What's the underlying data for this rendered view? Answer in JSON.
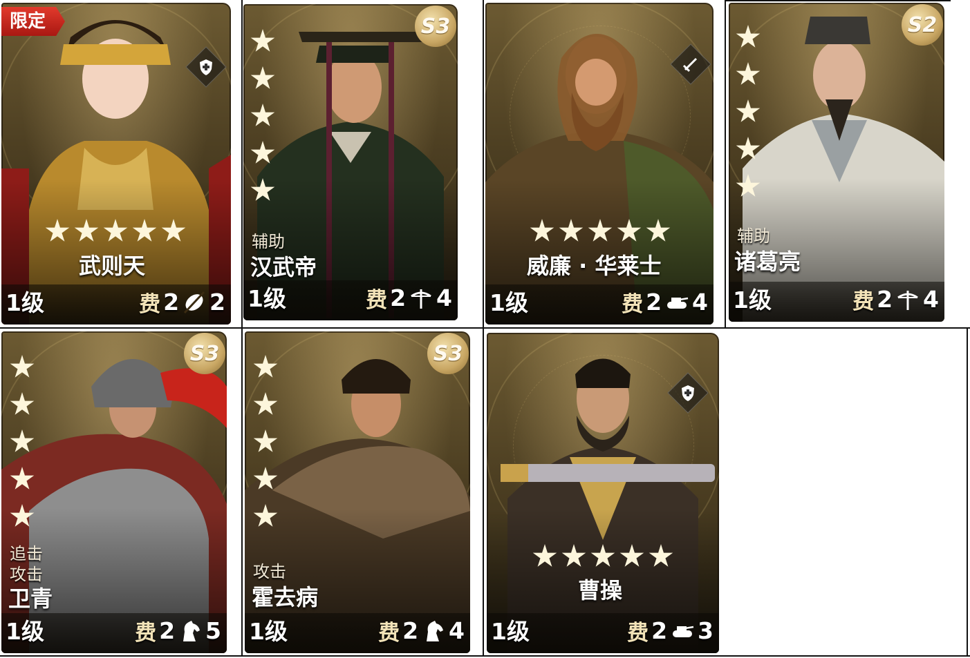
{
  "cards": [
    {
      "id": "c1",
      "limited_label": "限定",
      "stars": 5,
      "name": "武则天",
      "role": "",
      "level": "1级",
      "cost_label": "费",
      "cost": "2",
      "type_icon": "crossed-feather-icon",
      "type_value": "2",
      "badge": "",
      "class_icon": "shield-icon"
    },
    {
      "id": "c2",
      "limited_label": "",
      "stars": 5,
      "name": "汉武帝",
      "role": "辅助",
      "level": "1级",
      "cost_label": "费",
      "cost": "2",
      "type_icon": "crossbow-icon",
      "type_value": "4",
      "badge": "S3",
      "class_icon": ""
    },
    {
      "id": "c3",
      "limited_label": "",
      "stars": 5,
      "name": "威廉 · 华莱士",
      "role": "",
      "level": "1级",
      "cost_label": "费",
      "cost": "2",
      "type_icon": "tank-icon",
      "type_value": "4",
      "badge": "",
      "class_icon": "sword-icon"
    },
    {
      "id": "c4",
      "limited_label": "",
      "stars": 5,
      "name": "诸葛亮",
      "role": "辅助",
      "level": "1级",
      "cost_label": "费",
      "cost": "2",
      "type_icon": "crossbow-icon",
      "type_value": "4",
      "badge": "S2",
      "class_icon": ""
    },
    {
      "id": "c5",
      "limited_label": "",
      "stars": 5,
      "name": "卫青",
      "role_lines": [
        "追击",
        "攻击"
      ],
      "level": "1级",
      "cost_label": "费",
      "cost": "2",
      "type_icon": "horse-icon",
      "type_value": "5",
      "badge": "S3",
      "class_icon": ""
    },
    {
      "id": "c6",
      "limited_label": "",
      "stars": 5,
      "name": "霍去病",
      "role": "攻击",
      "level": "1级",
      "cost_label": "费",
      "cost": "2",
      "type_icon": "horse-icon",
      "type_value": "4",
      "badge": "S3",
      "class_icon": ""
    },
    {
      "id": "c7",
      "limited_label": "",
      "stars": 5,
      "name": "曹操",
      "role": "",
      "level": "1级",
      "cost_label": "费",
      "cost": "2",
      "type_icon": "tank-icon",
      "type_value": "3",
      "badge": "",
      "class_icon": "shield-icon"
    }
  ]
}
